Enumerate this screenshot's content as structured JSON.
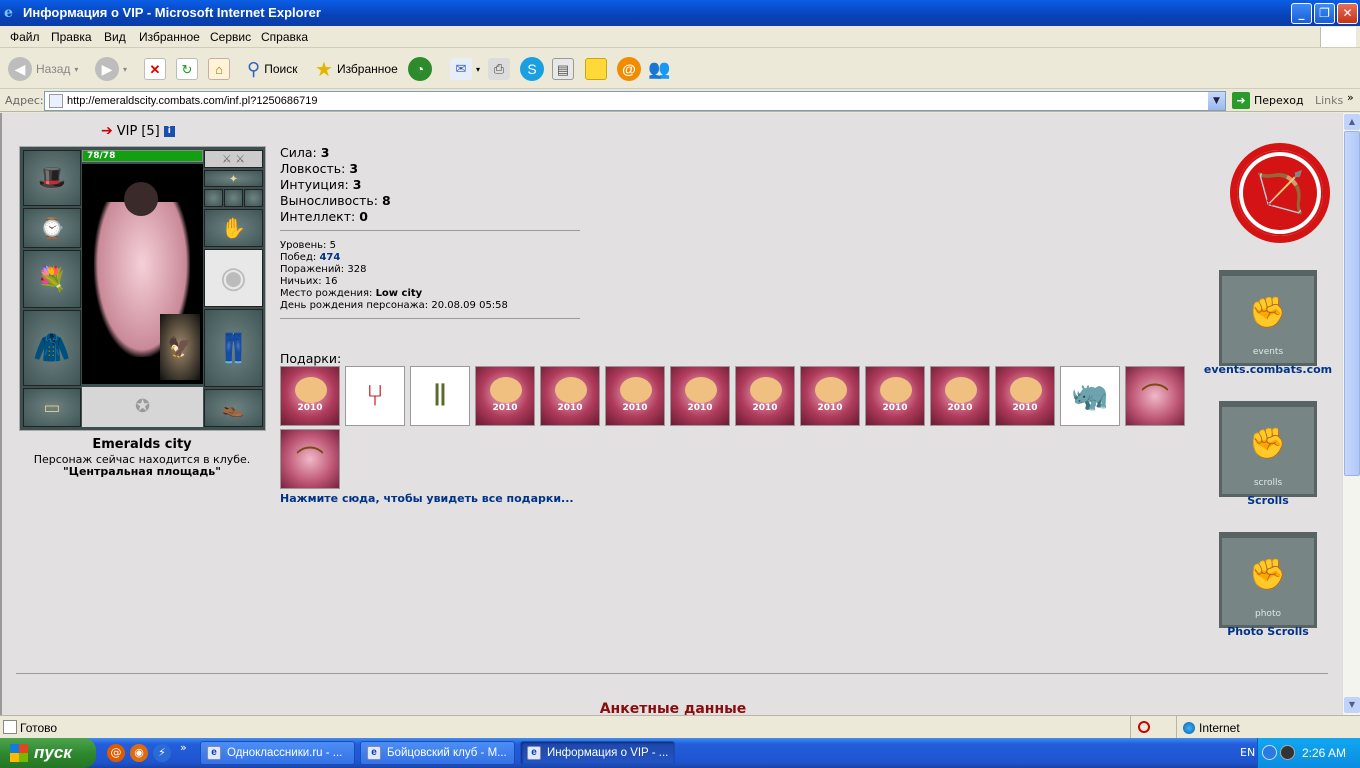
{
  "window": {
    "title": "Информация о VIP - Microsoft Internet Explorer",
    "minimize": "_",
    "restore": "❐",
    "close": "✕"
  },
  "menu": [
    "Файл",
    "Правка",
    "Вид",
    "Избранное",
    "Сервис",
    "Справка"
  ],
  "toolbar": {
    "back_label": "Назад",
    "search_label": "Поиск",
    "favorites_label": "Избранное"
  },
  "address": {
    "label": "Адрес:",
    "url": "http://emeraldscity.combats.com/inf.pl?1250686719",
    "go_label": "Переход",
    "links_label": "Links"
  },
  "profile": {
    "name": "VIP",
    "level_tag": "[5]",
    "hp": "78/78",
    "hp_fraction": 1.0,
    "city": "Emeralds city",
    "location_note": "Персонаж сейчас находится в клубе.",
    "location_place": "\"Центральная площадь\""
  },
  "stats": [
    {
      "label": "Сила:",
      "value": "3"
    },
    {
      "label": "Ловкость:",
      "value": "3"
    },
    {
      "label": "Интуиция:",
      "value": "3"
    },
    {
      "label": "Выносливость:",
      "value": "8"
    },
    {
      "label": "Интеллект:",
      "value": "0"
    }
  ],
  "info": {
    "level_label": "Уровень:",
    "level": "5",
    "wins_label": "Побед:",
    "wins": "474",
    "losses_label": "Поражений:",
    "losses": "328",
    "draws_label": "Ничьих:",
    "draws": "16",
    "birthplace_label": "Место рождения:",
    "birthplace": "Low city",
    "birthday_label": "День рождения персонажа:",
    "birthday": "20.08.09 05:58"
  },
  "gifts": {
    "label": "Подарки:",
    "year_badge": "2010",
    "more_link": "Нажмите сюда, чтобы увидеть все подарки..."
  },
  "sidebar_links": {
    "events": "events.combats.com",
    "events_banner": "events",
    "scrolls": "Scrolls",
    "scrolls_banner": "scrolls",
    "photo": "Photo Scrolls",
    "photo_banner": "photo"
  },
  "section_heading": "Анкетные данные",
  "status": {
    "text": "Готово",
    "zone": "Internet"
  },
  "taskbar": {
    "start_label": "пуск",
    "tasks": [
      "Одноклассники.ru - ...",
      "Бойцовский клуб - M...",
      "Информация о VIP - ..."
    ],
    "lang": "EN",
    "clock": "2:26 AM"
  },
  "colors": {
    "page_bg": "#E2E0E0",
    "link_blue": "#003388",
    "heading_red": "#8a0c0c",
    "hp_green": "#10a010"
  }
}
